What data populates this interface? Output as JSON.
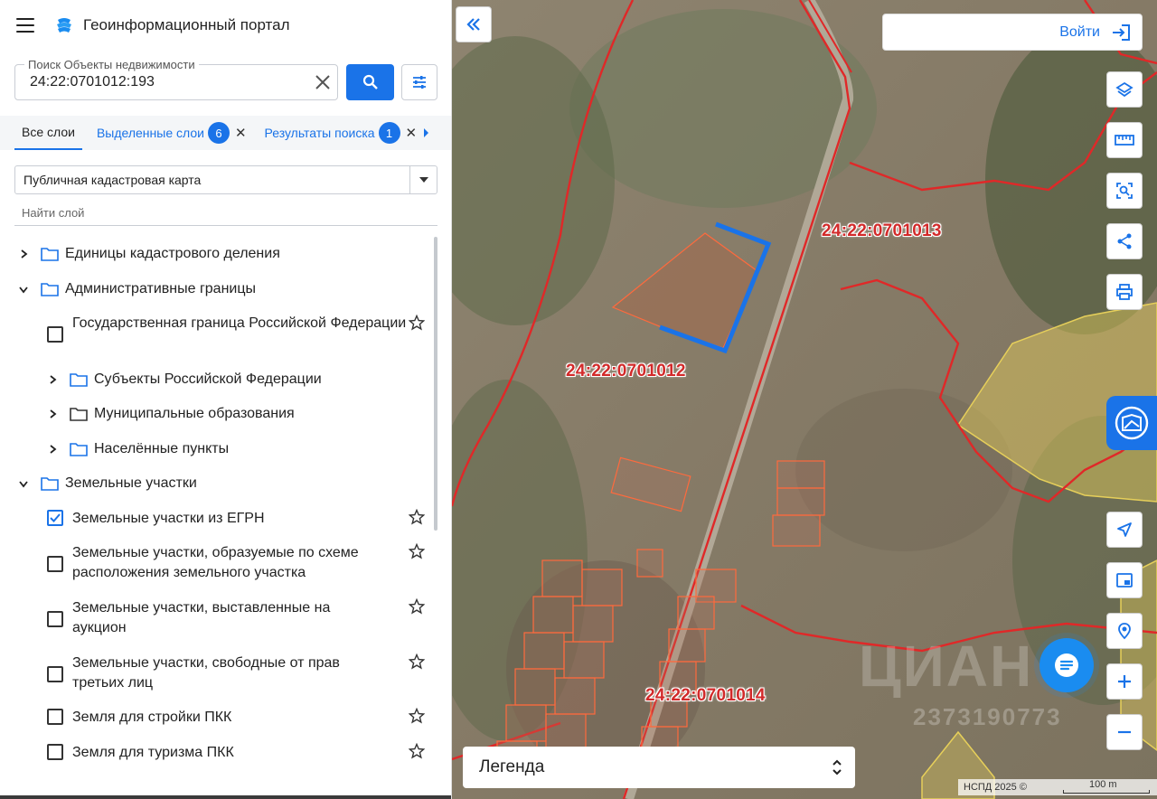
{
  "app": {
    "title": "Геоинформационный портал"
  },
  "search": {
    "label": "Поиск Объекты недвижимости",
    "value": "24:22:0701012:193"
  },
  "tabs": [
    {
      "label": "Все слои",
      "active": true
    },
    {
      "label": "Выделенные слои",
      "badge": "6"
    },
    {
      "label": "Результаты поиска",
      "badge": "1"
    }
  ],
  "layer_select": {
    "value": "Публичная кадастровая карта"
  },
  "layer_search": {
    "placeholder": "Найти слой"
  },
  "tree": {
    "cadastral_units": "Единицы кадастрового деления",
    "admin_borders": "Административные границы",
    "state_border": "Государственная граница Российской Федерации",
    "subjects": "Субъекты Российской Федерации",
    "municipal": "Муниципальные образования",
    "settlements": "Населённые пункты",
    "land_plots": "Земельные участки",
    "egrn_plots": "Земельные участки из ЕГРН",
    "scheme_plots_line1": "Земельные участки, образуемые по схеме",
    "scheme_plots_line2": "расположения земельного участка",
    "auction_line1": "Земельные участки, выставленные на",
    "auction_line2": "аукцион",
    "free_line1": "Земельные участки, свободные от прав",
    "free_line2": "третьих лиц",
    "build_pkk": "Земля для стройки ПКК",
    "tourism_pkk": "Земля для туризма ПКК"
  },
  "map": {
    "labels": {
      "q1": "24:22:0701013",
      "q2": "24:22:0701012",
      "q3": "24:22:0701014"
    },
    "watermark": "ЦИАН",
    "watermark_id": "2373190773",
    "attribution": "НСПД 2025 ©",
    "scale": "100 m"
  },
  "login": {
    "label": "Войти"
  },
  "legend": {
    "label": "Легенда"
  },
  "colors": {
    "accent": "#1a73e8",
    "boundary": "#e02828",
    "plot_outline": "#ff6a3d",
    "selected_plot": "#1a73e8",
    "yellow_zone": "#e6cf5a"
  },
  "icons": {
    "menu": "burger-menu-icon",
    "search": "search-icon",
    "filter": "tune-icon",
    "folder": "folder-icon",
    "star": "star-icon",
    "layers": "layers-icon",
    "ruler": "ruler-icon",
    "select": "area-select-icon",
    "share": "share-icon",
    "print": "print-icon",
    "locate": "navigation-icon",
    "minimap": "minimap-icon",
    "point": "point-search-icon",
    "zoom_in": "plus-icon",
    "zoom_out": "minus-icon",
    "chat": "chat-icon",
    "login": "login-icon"
  }
}
